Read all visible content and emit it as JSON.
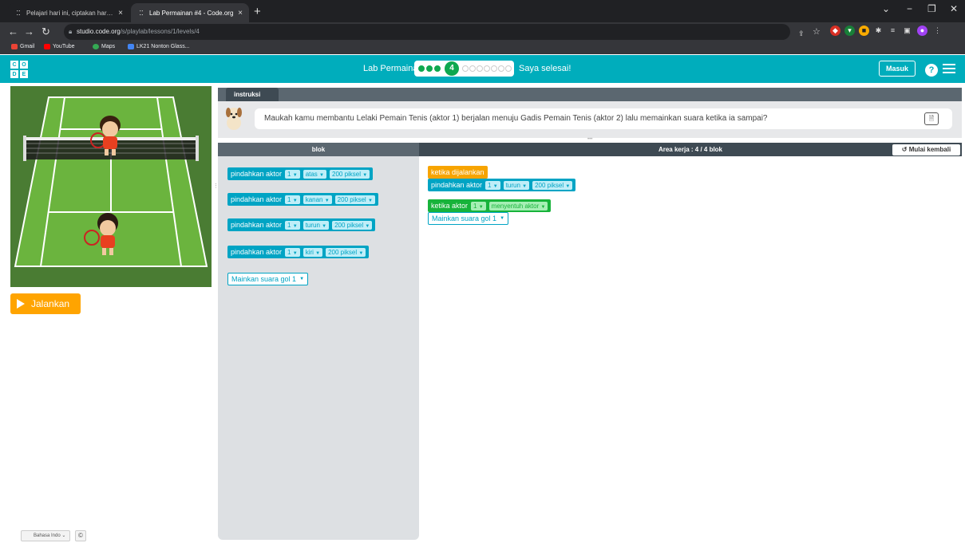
{
  "browser": {
    "tabs": [
      {
        "title": "Pelajari hari ini, ciptakan hari esok",
        "favicon": "codeorg-icon",
        "close": "×"
      },
      {
        "title": "Lab Permainan #4 - Code.org",
        "favicon": "codeorg-icon",
        "close": "×"
      }
    ],
    "newtab": "+",
    "url_host": "studio.code.org",
    "url_path": "/s/playlab/lessons/1/levels/4",
    "bookmarks": [
      {
        "label": "Gmail",
        "color": "#ea4335"
      },
      {
        "label": "YouTube",
        "color": "#ff0000"
      },
      {
        "label": "Maps",
        "color": "#34a853"
      },
      {
        "label": "LK21 Nonton Glass...",
        "color": "#4285f4"
      }
    ]
  },
  "header": {
    "logo_letters": [
      "C",
      "O",
      "D",
      "E"
    ],
    "lab_label": "Lab Permainan",
    "current_level": "4",
    "finish_label": "Saya selesai!",
    "login_label": "Masuk",
    "help_label": "?"
  },
  "instructions": {
    "tab_label": "instruksi",
    "text": "Maukah kamu membantu Lelaki Pemain Tenis (aktor 1) berjalan menuju Gadis Pemain Tenis (aktor 2) lalu memainkan suara ketika ia sampai?"
  },
  "toolbox": {
    "header": "blok",
    "blocks": [
      {
        "label": "pindahkan aktor",
        "actor": "1",
        "dir": "atas",
        "dist": "200 piksel"
      },
      {
        "label": "pindahkan aktor",
        "actor": "1",
        "dir": "kanan",
        "dist": "200 piksel"
      },
      {
        "label": "pindahkan aktor",
        "actor": "1",
        "dir": "turun",
        "dist": "200 piksel"
      },
      {
        "label": "pindahkan aktor",
        "actor": "1",
        "dir": "kiri",
        "dist": "200 piksel"
      }
    ],
    "sound_block": "Mainkan suara gol 1"
  },
  "workspace": {
    "header": "Area kerja : 4 / 4 blok",
    "reset_label": "Mulai kembali",
    "event1": "ketika dijalankan",
    "move": {
      "label": "pindahkan aktor",
      "actor": "1",
      "dir": "turun",
      "dist": "200 piksel"
    },
    "event2": {
      "label": "ketika aktor",
      "actor": "1",
      "target": "menyentuh aktor"
    },
    "sound": "Mainkan suara gol 1"
  },
  "left": {
    "run_label": "Jalankan",
    "language": "Bahasa Indo",
    "copyright": "©"
  },
  "colors": {
    "codeorg_teal": "#00adbc",
    "progress_green": "#0ea84f",
    "run_orange": "#ffa400",
    "block_teal": "#00a4c4",
    "event_orange": "#f7a400",
    "event_green": "#17b33a"
  }
}
